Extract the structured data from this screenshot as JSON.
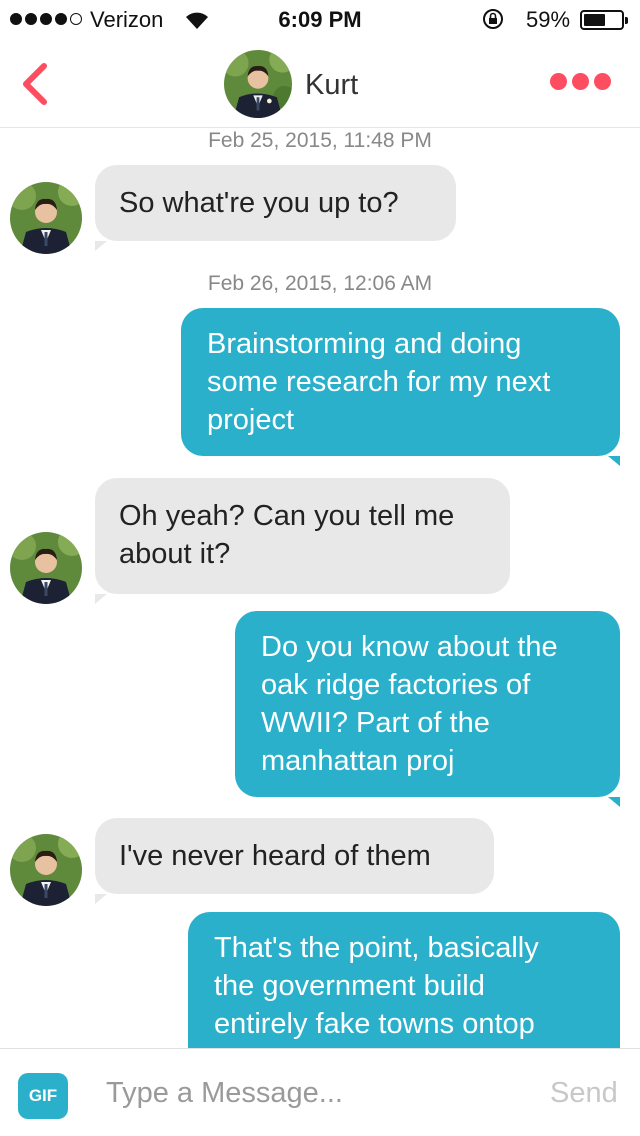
{
  "status_bar": {
    "carrier": "Verizon",
    "time": "6:09 PM",
    "battery_percent": "59%",
    "battery_level": 0.59,
    "signal_bars_filled": 4,
    "signal_bars_total": 5
  },
  "header": {
    "back_icon": "chevron-left-icon",
    "contact_name": "Kurt",
    "more_icon": "more-dots-icon",
    "accent_color": "#fd4d60"
  },
  "messages": [
    {
      "timestamp": "Feb 25, 2015, 11:48 PM"
    },
    {
      "direction": "incoming",
      "lines": [
        "So what're you up to?"
      ]
    },
    {
      "timestamp": "Feb 26, 2015, 12:06 AM"
    },
    {
      "direction": "outgoing",
      "lines": [
        "Brainstorming and doing",
        "some research for my next",
        "project"
      ]
    },
    {
      "direction": "incoming",
      "lines": [
        "Oh yeah? Can you tell me",
        "about it?"
      ]
    },
    {
      "direction": "outgoing",
      "lines": [
        "Do you know about the",
        "oak ridge factories of",
        "WWII? Part of the",
        "manhattan proj"
      ]
    },
    {
      "direction": "incoming",
      "lines": [
        "I've never heard of them"
      ]
    },
    {
      "direction": "outgoing",
      "lines": [
        "That's the point, basically",
        "the government build",
        "entirely fake towns ontop"
      ]
    }
  ],
  "composer": {
    "gif_label": "GIF",
    "placeholder": "Type a Message...",
    "send_label": "Send"
  },
  "colors": {
    "outgoing_bubble": "#2ab0ca",
    "incoming_bubble": "#e8e8e8",
    "timestamp": "#888888"
  }
}
